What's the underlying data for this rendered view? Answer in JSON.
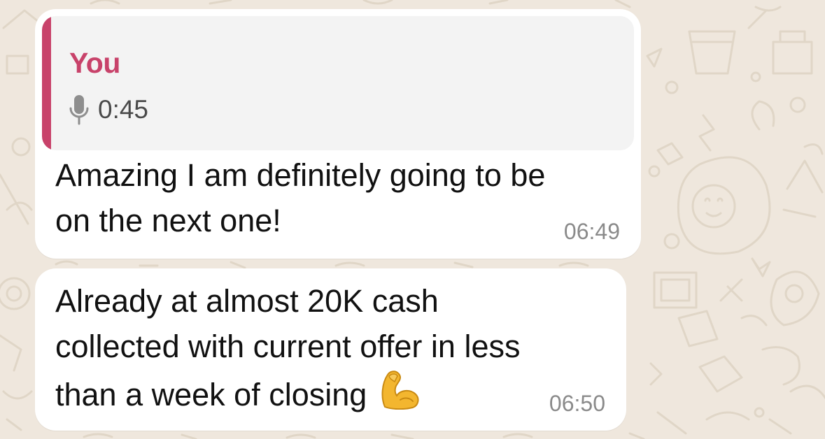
{
  "colors": {
    "wallpaper": "#efe7dd",
    "bubble": "#ffffff",
    "quote_background": "#f3f3f3",
    "quote_accent": "#c8426a",
    "timestamp": "#8a8a8a"
  },
  "messages": [
    {
      "reply_to": {
        "author": "You",
        "icon": "microphone-icon",
        "duration": "0:45"
      },
      "text": "Amazing I am definitely going to be\non the next one!",
      "time": "06:49"
    },
    {
      "text": "Already at almost 20K cash\ncollected with current offer in less\nthan a week of closing",
      "emoji": "flexed-biceps-emoji",
      "time": "06:50"
    }
  ]
}
